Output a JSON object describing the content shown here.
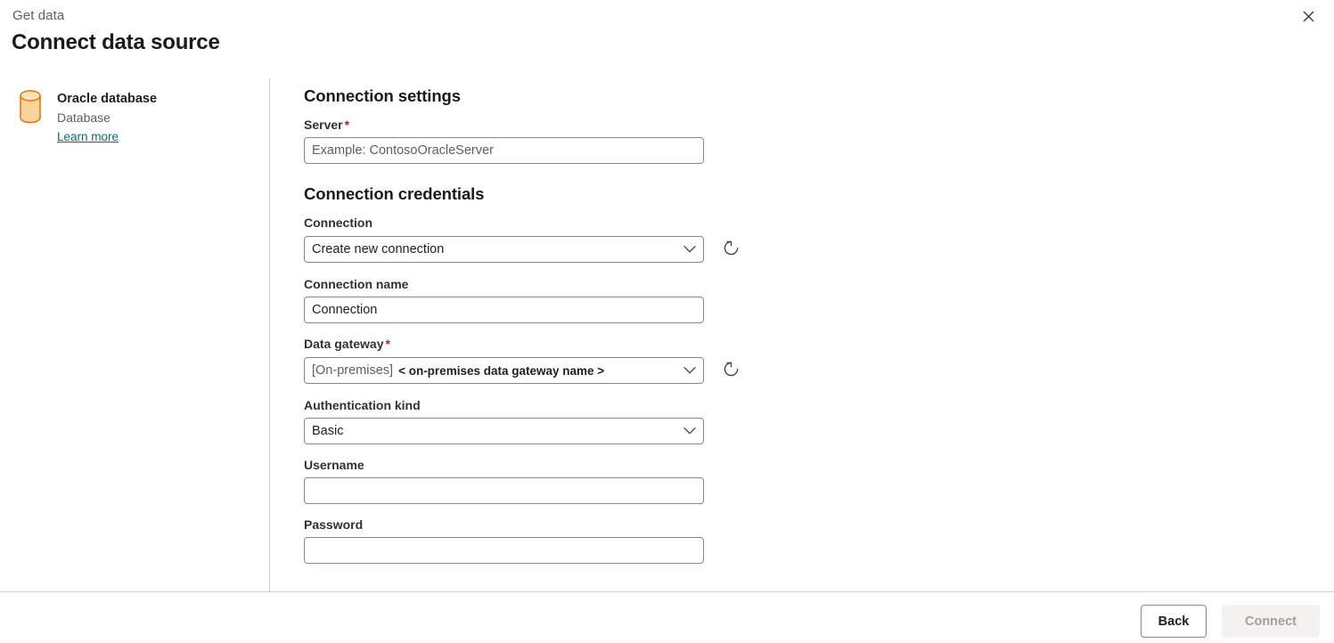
{
  "header": {
    "eyebrow": "Get data",
    "title": "Connect data source",
    "close_icon": "close-icon"
  },
  "sidebar": {
    "icon": "database-cylinder-icon",
    "source_name": "Oracle database",
    "source_type": "Database",
    "learn_more": "Learn more"
  },
  "form": {
    "connection_settings": {
      "heading": "Connection settings",
      "server": {
        "label": "Server",
        "required_marker": "*",
        "placeholder": "Example: ContosoOracleServer",
        "value": ""
      }
    },
    "connection_credentials": {
      "heading": "Connection credentials",
      "connection": {
        "label": "Connection",
        "selected": "Create new connection",
        "chevron_icon": "chevron-down-icon",
        "refresh_icon": "refresh-icon"
      },
      "connection_name": {
        "label": "Connection name",
        "value": "Connection",
        "placeholder": ""
      },
      "data_gateway": {
        "label": "Data gateway",
        "required_marker": "*",
        "selected_prefix": "[On-premises]",
        "selected_name": "< on-premises data gateway name >",
        "chevron_icon": "chevron-down-icon",
        "refresh_icon": "refresh-icon"
      },
      "authentication_kind": {
        "label": "Authentication kind",
        "selected": "Basic",
        "chevron_icon": "chevron-down-icon"
      },
      "username": {
        "label": "Username",
        "value": "",
        "placeholder": ""
      },
      "password": {
        "label": "Password",
        "value": "",
        "placeholder": ""
      }
    }
  },
  "footer": {
    "back_label": "Back",
    "connect_label": "Connect"
  },
  "colors": {
    "link": "#0f6c6c",
    "required": "#a4262c",
    "border": "#8a8886",
    "divider": "#d2d0ce",
    "disabled_bg": "#f3f2f1",
    "disabled_text": "#a19f9d",
    "icon_body": "#f9d49b",
    "icon_stroke": "#e07b14"
  }
}
